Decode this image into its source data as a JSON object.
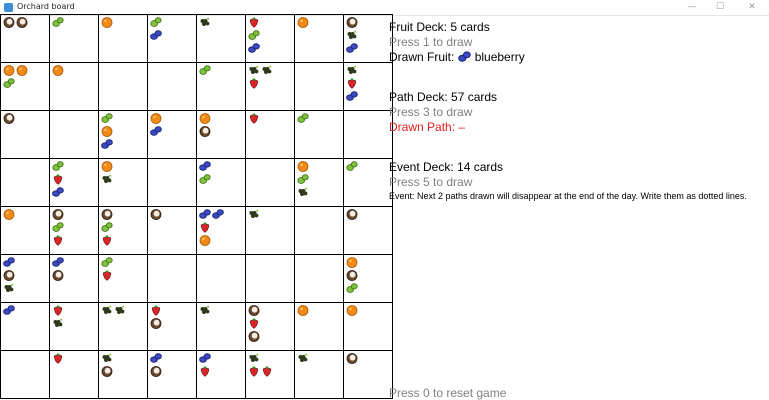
{
  "window": {
    "title": "Orchard board",
    "minimize": "—",
    "maximize": "☐",
    "close": "✕"
  },
  "board": {
    "rows": [
      [
        [
          [
            "coconut",
            "coconut"
          ]
        ],
        [
          [
            "pear"
          ]
        ],
        [
          [
            "orange"
          ]
        ],
        [
          [
            "pear"
          ],
          [
            "blueberry"
          ]
        ],
        [
          [
            "grapes"
          ]
        ],
        [
          [
            "strawberry"
          ],
          [
            "pear"
          ],
          [
            "blueberry"
          ]
        ],
        [
          [
            "orange"
          ]
        ],
        [
          [
            "coconut"
          ],
          [
            "grapes"
          ],
          [
            "blueberry"
          ]
        ]
      ],
      [
        [
          [
            "orange",
            "orange"
          ],
          [
            "pear"
          ]
        ],
        [
          [
            "orange"
          ]
        ],
        [],
        [],
        [
          [
            "pear"
          ]
        ],
        [
          [
            "grapes",
            "grapes"
          ],
          [
            "strawberry"
          ]
        ],
        [],
        [
          [
            "grapes"
          ],
          [
            "strawberry"
          ],
          [
            "blueberry"
          ]
        ]
      ],
      [
        [
          [
            "coconut"
          ]
        ],
        [],
        [
          [
            "pear"
          ],
          [
            "orange"
          ],
          [
            "blueberry"
          ]
        ],
        [
          [
            "orange"
          ],
          [
            "blueberry"
          ]
        ],
        [
          [
            "orange"
          ],
          [
            "coconut"
          ]
        ],
        [
          [
            "strawberry"
          ]
        ],
        [
          [
            "pear"
          ]
        ],
        []
      ],
      [
        [],
        [
          [
            "pear"
          ],
          [
            "strawberry"
          ],
          [
            "blueberry"
          ]
        ],
        [
          [
            "orange"
          ],
          [
            "grapes"
          ]
        ],
        [],
        [
          [
            "blueberry"
          ],
          [
            "pear"
          ]
        ],
        [],
        [
          [
            "orange"
          ],
          [
            "pear"
          ],
          [
            "grapes"
          ]
        ],
        [
          [
            "pear"
          ]
        ]
      ],
      [
        [
          [
            "orange"
          ]
        ],
        [
          [
            "coconut"
          ],
          [
            "pear"
          ],
          [
            "strawberry"
          ]
        ],
        [
          [
            "coconut"
          ],
          [
            "pear"
          ],
          [
            "strawberry"
          ]
        ],
        [
          [
            "coconut"
          ]
        ],
        [
          [
            "blueberry",
            "blueberry"
          ],
          [
            "strawberry"
          ],
          [
            "orange"
          ]
        ],
        [
          [
            "grapes"
          ]
        ],
        [],
        [
          [
            "coconut"
          ]
        ]
      ],
      [
        [
          [
            "blueberry"
          ],
          [
            "coconut"
          ],
          [
            "grapes"
          ]
        ],
        [
          [
            "blueberry"
          ],
          [
            "coconut"
          ]
        ],
        [
          [
            "pear"
          ],
          [
            "strawberry"
          ]
        ],
        [],
        [],
        [],
        [],
        [
          [
            "orange"
          ],
          [
            "coconut"
          ],
          [
            "pear"
          ]
        ]
      ],
      [
        [
          [
            "blueberry"
          ]
        ],
        [
          [
            "strawberry"
          ],
          [
            "grapes"
          ]
        ],
        [
          [
            "grapes",
            "grapes"
          ]
        ],
        [
          [
            "strawberry"
          ],
          [
            "coconut"
          ]
        ],
        [
          [
            "grapes"
          ]
        ],
        [
          [
            "coconut"
          ],
          [
            "strawberry"
          ],
          [
            "coconut"
          ]
        ],
        [
          [
            "orange"
          ]
        ],
        [
          [
            "orange"
          ]
        ]
      ],
      [
        [],
        [
          [
            "strawberry"
          ]
        ],
        [
          [
            "grapes"
          ],
          [
            "coconut"
          ]
        ],
        [
          [
            "blueberry"
          ],
          [
            "coconut"
          ]
        ],
        [
          [
            "blueberry"
          ],
          [
            "strawberry"
          ]
        ],
        [
          [
            "grapes"
          ],
          [
            "strawberry",
            "strawberry"
          ]
        ],
        [
          [
            "grapes"
          ]
        ],
        [
          [
            "coconut"
          ]
        ]
      ]
    ]
  },
  "fruit_deck": {
    "title": "Fruit Deck: 5 cards",
    "hint": "Press 1 to draw",
    "drawn_label": "Drawn Fruit:",
    "drawn_icon": "blueberry",
    "drawn_value": "blueberry"
  },
  "path_deck": {
    "title": "Path Deck: 57 cards",
    "hint": "Press 3 to draw",
    "drawn_label": "Drawn Path: –"
  },
  "event_deck": {
    "title": "Event Deck: 14 cards",
    "hint": "Press 5 to draw",
    "event_text": "Event: Next 2 paths drawn will disappear at the end of the day. Write them as dotted lines."
  },
  "reset_hint": "Press 0 to reset game",
  "colors": {
    "grid_line": "#000000",
    "hint_text": "#808080",
    "drawn_path": "#e02020",
    "orange": "#f28a1a",
    "pear": "#7cc23a",
    "blueberry": "#3b49c4",
    "strawberry": "#d8262b",
    "coconut": "#6b4a2e",
    "grapes": "#2f3a1c"
  }
}
